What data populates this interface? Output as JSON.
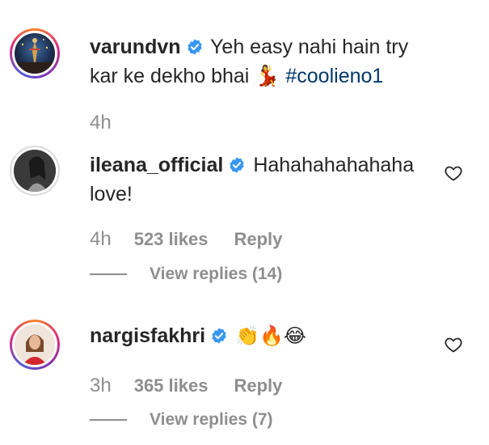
{
  "comments": [
    {
      "username": "varundvn",
      "text_before_hashtag": "Yeh easy nahi hain try kar ke dekho bhai 💃 ",
      "hashtag": "#coolieno1",
      "time": "4h"
    },
    {
      "username": "ileana_official",
      "text": "Hahahahahahaha love!",
      "time": "4h",
      "likes": "523 likes",
      "reply_label": "Reply",
      "view_replies": "View replies (14)"
    },
    {
      "username": "nargisfakhri",
      "emojis": "👏🔥😂",
      "time": "3h",
      "likes": "365 likes",
      "reply_label": "Reply",
      "view_replies": "View replies (7)"
    }
  ],
  "colors": {
    "text": "#262626",
    "meta": "#8e8e8e",
    "hashtag": "#00376b",
    "verified": "#3897f0"
  },
  "icons": {
    "verified": "verified-badge-icon",
    "heart": "heart-outline-icon"
  }
}
